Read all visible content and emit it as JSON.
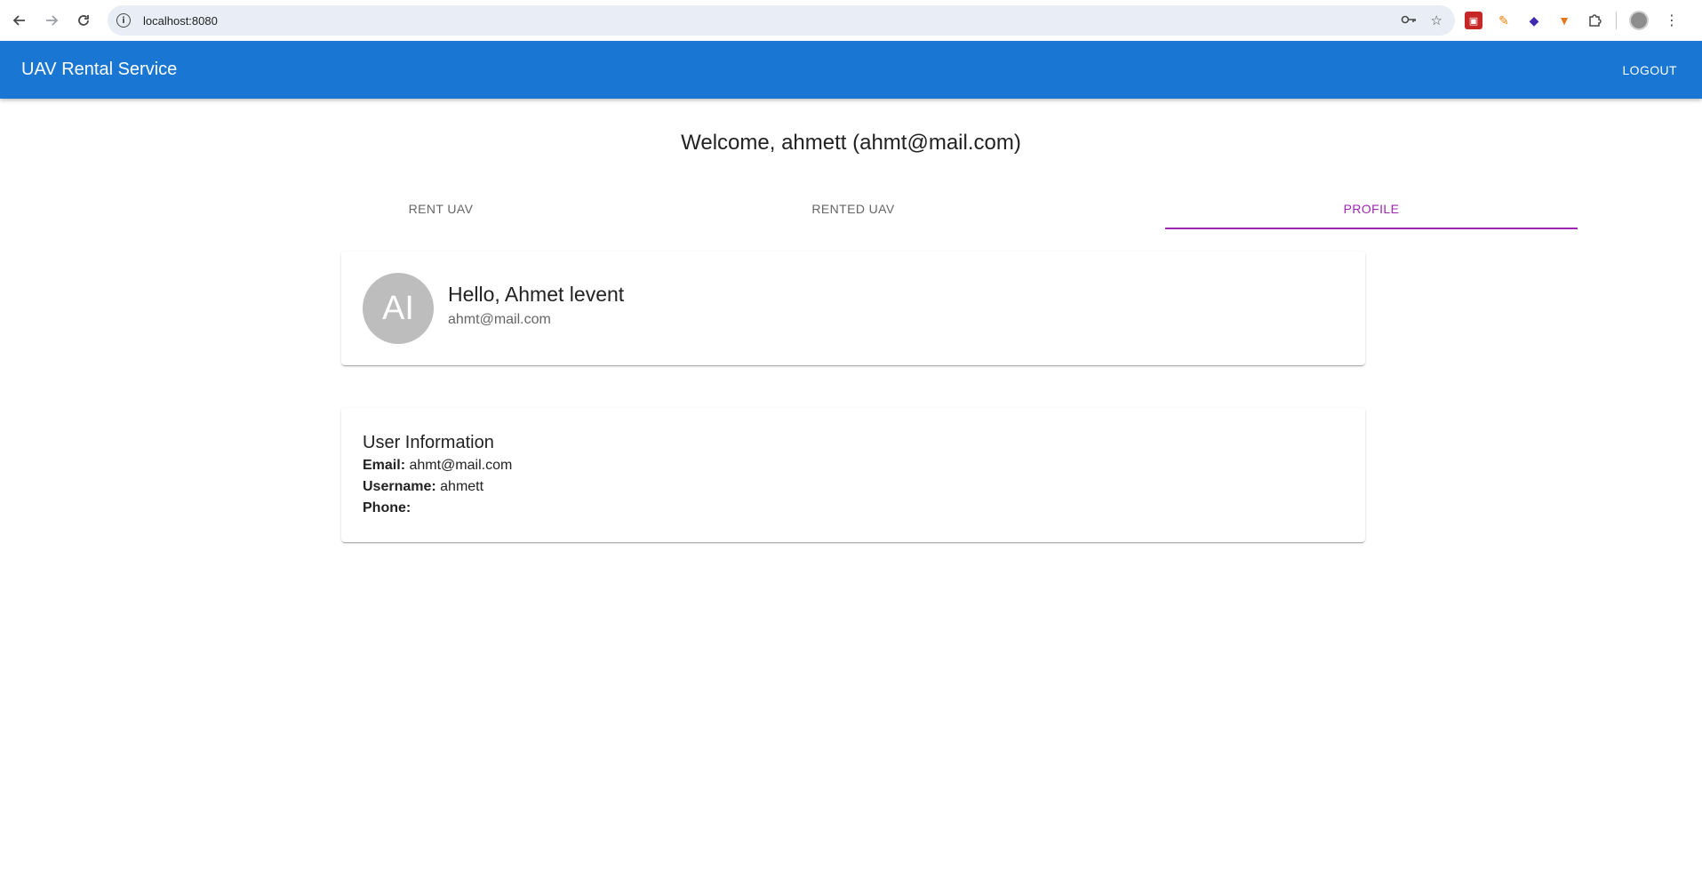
{
  "browser": {
    "url": "localhost:8080",
    "icons": [
      "back-icon",
      "forward-icon",
      "reload-icon",
      "site-info-icon",
      "password-key-icon",
      "bookmark-star-icon",
      "extensions-puzzle-icon",
      "kebab-menu-icon"
    ]
  },
  "app_bar": {
    "title": "UAV Rental Service",
    "logout_label": "LOGOUT",
    "color": "#1976d2"
  },
  "welcome": "Welcome, ahmett (ahmt@mail.com)",
  "tabs": [
    {
      "label": "RENT UAV",
      "active": false
    },
    {
      "label": "RENTED UAV",
      "active": false
    },
    {
      "label": "PROFILE",
      "active": true
    }
  ],
  "tab_active_color": "#9c27b0",
  "profile_card": {
    "avatar_initials": "AI",
    "greeting": "Hello, Ahmet levent",
    "email": "ahmt@mail.com"
  },
  "user_info": {
    "title": "User Information",
    "email_label": "Email:",
    "email_value": "ahmt@mail.com",
    "username_label": "Username:",
    "username_value": "ahmett",
    "phone_label": "Phone:",
    "phone_value": ""
  }
}
